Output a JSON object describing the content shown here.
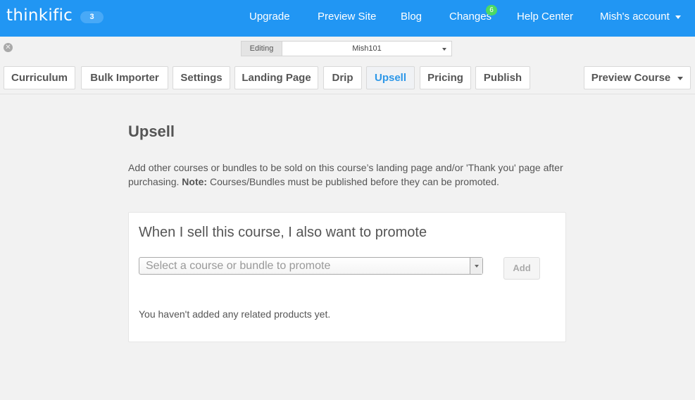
{
  "header": {
    "logo": "thinkific",
    "logo_badge": "3",
    "nav": {
      "upgrade": "Upgrade",
      "preview_site": "Preview Site",
      "blog": "Blog",
      "changes": "Changes",
      "changes_badge": "6",
      "help_center": "Help Center",
      "account": "Mish's account"
    }
  },
  "editing": {
    "label": "Editing",
    "course": "Mish101"
  },
  "tabs": {
    "curriculum": "Curriculum",
    "bulk_importer": "Bulk Importer",
    "settings": "Settings",
    "landing_page": "Landing Page",
    "drip": "Drip",
    "upsell": "Upsell",
    "pricing": "Pricing",
    "publish": "Publish",
    "preview_course": "Preview Course"
  },
  "main": {
    "title": "Upsell",
    "description_1": "Add other courses or bundles to be sold on this course’s landing page and/or 'Thank you' page after purchasing. ",
    "note_label": "Note:",
    "description_2": " Courses/Bundles must be published before they can be promoted.",
    "card": {
      "title": "When I sell this course, I also want to promote",
      "select_placeholder": "Select a course or bundle to promote",
      "add_label": "Add",
      "empty_message": "You haven't added any related products yet."
    }
  },
  "colors": {
    "header_bg": "#2196f3",
    "active_tab_text": "#2c97e8",
    "badge_green": "#4cd964"
  }
}
